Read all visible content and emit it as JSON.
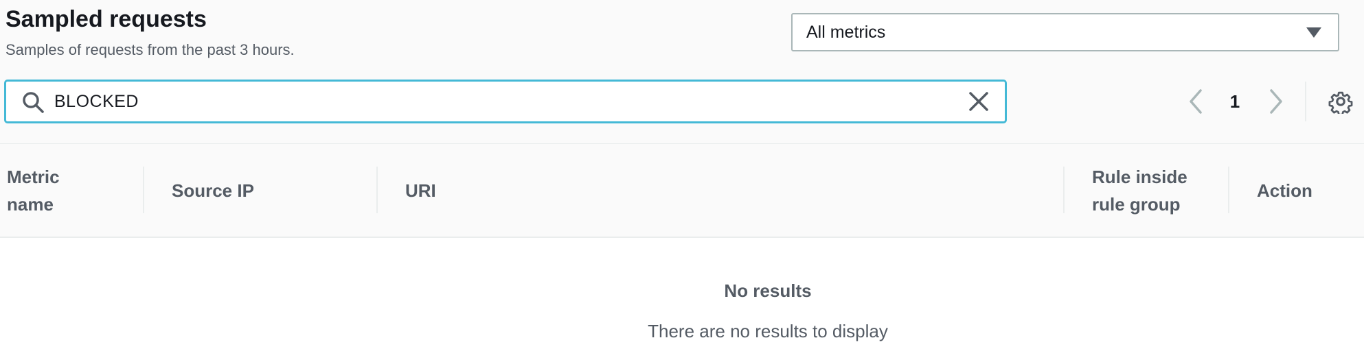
{
  "header": {
    "title": "Sampled requests",
    "subtitle": "Samples of requests from the past 3 hours."
  },
  "metric_filter": {
    "selected": "All metrics"
  },
  "search": {
    "value": "BLOCKED"
  },
  "pagination": {
    "current_page": "1"
  },
  "table": {
    "columns": [
      {
        "label": "Metric name"
      },
      {
        "label": "Source IP"
      },
      {
        "label": "URI"
      },
      {
        "label": "Rule inside rule group"
      },
      {
        "label": "Action"
      }
    ],
    "empty": {
      "title": "No results",
      "description": "There are no results to display"
    }
  },
  "icons": {
    "search": "search-icon",
    "clear": "close-icon",
    "prev": "chevron-left-icon",
    "next": "chevron-right-icon",
    "settings": "gear-icon",
    "dropdown": "caret-down-icon"
  },
  "colors": {
    "focus_border": "#44b9d6",
    "text_primary": "#16191f",
    "text_secondary": "#545b64",
    "disabled": "#aab7b8"
  }
}
